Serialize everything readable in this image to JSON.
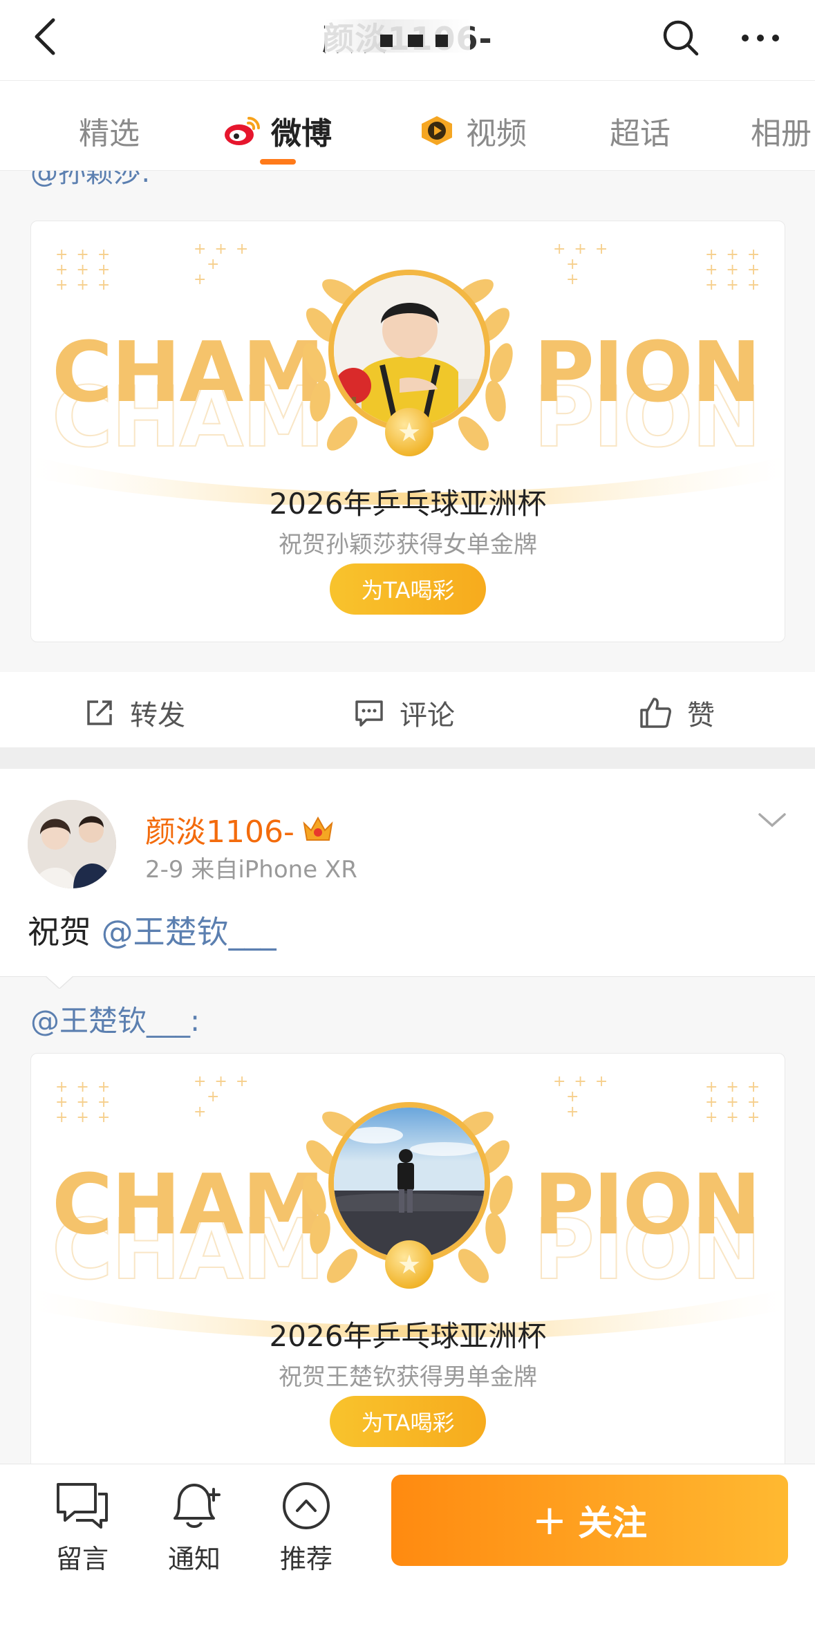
{
  "header": {
    "title": "颜淡1106-",
    "back_icon": "chevron-left-icon",
    "search_icon": "search-icon",
    "more_icon": "more-horizontal-icon"
  },
  "tabs": [
    {
      "label": "精选",
      "active": false
    },
    {
      "label": "微博",
      "active": true,
      "icon": "weibo-logo-icon"
    },
    {
      "label": "视频",
      "active": false,
      "icon": "video-play-icon"
    },
    {
      "label": "超话",
      "active": false
    },
    {
      "label": "相册",
      "active": false
    }
  ],
  "feed": {
    "partial_mention": "@孙颖莎:",
    "card1": {
      "banner_left": "CHAM",
      "banner_right": "PION",
      "title": "2026年乒乓球亚洲杯",
      "subtitle": "祝贺孙颖莎获得女单金牌",
      "cheer_label": "为TA喝彩"
    },
    "actions": {
      "repost": "转发",
      "comment": "评论",
      "like": "赞"
    },
    "post2": {
      "username": "颜淡1106-",
      "meta": "2-9  来自iPhone XR",
      "text_prefix": "祝贺 ",
      "text_mention": "@王楚钦___",
      "quote_mention": "@王楚钦___:",
      "card": {
        "banner_left": "CHAM",
        "banner_right": "PION",
        "title": "2026年乒乓球亚洲杯",
        "subtitle": "祝贺王楚钦获得男单金牌",
        "cheer_label": "为TA喝彩"
      }
    }
  },
  "bottombar": {
    "message": "留言",
    "notify": "通知",
    "recommend": "推荐",
    "follow_label": "关注",
    "follow_plus": "+"
  },
  "colors": {
    "accent_orange": "#ff8a10",
    "username_orange": "#f36b0c",
    "mention_blue": "#5b7fb0",
    "champion_gold": "#f5c36b"
  }
}
